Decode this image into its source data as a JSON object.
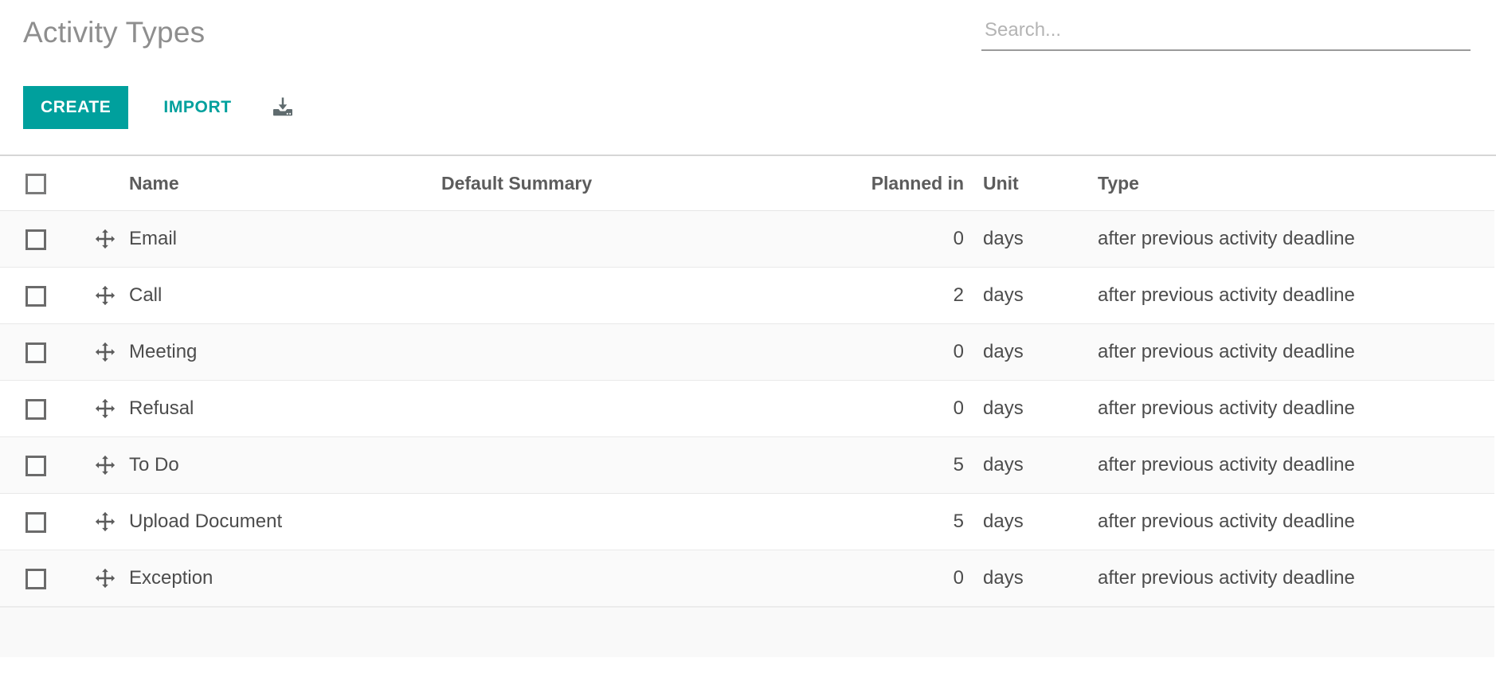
{
  "header": {
    "title": "Activity Types",
    "create_label": "CREATE",
    "import_label": "IMPORT",
    "export_icon": "download-export-icon"
  },
  "search": {
    "placeholder": "Search...",
    "value": ""
  },
  "table": {
    "columns": {
      "name": "Name",
      "default_summary": "Default Summary",
      "planned_in": "Planned in",
      "unit": "Unit",
      "type": "Type"
    },
    "rows": [
      {
        "name": "Email",
        "default_summary": "",
        "planned_in": "0",
        "unit": "days",
        "type": "after previous activity deadline"
      },
      {
        "name": "Call",
        "default_summary": "",
        "planned_in": "2",
        "unit": "days",
        "type": "after previous activity deadline"
      },
      {
        "name": "Meeting",
        "default_summary": "",
        "planned_in": "0",
        "unit": "days",
        "type": "after previous activity deadline"
      },
      {
        "name": "Refusal",
        "default_summary": "",
        "planned_in": "0",
        "unit": "days",
        "type": "after previous activity deadline"
      },
      {
        "name": "To Do",
        "default_summary": "",
        "planned_in": "5",
        "unit": "days",
        "type": "after previous activity deadline"
      },
      {
        "name": "Upload Document",
        "default_summary": "",
        "planned_in": "5",
        "unit": "days",
        "type": "after previous activity deadline"
      },
      {
        "name": "Exception",
        "default_summary": "",
        "planned_in": "0",
        "unit": "days",
        "type": "after previous activity deadline"
      }
    ]
  },
  "colors": {
    "accent": "#00a09d",
    "title_text": "#8e8e8e",
    "body_text": "#4c4c4c",
    "header_text": "#5c5c5c",
    "row_stripe": "#fafafa",
    "border": "#e9e9e9"
  }
}
